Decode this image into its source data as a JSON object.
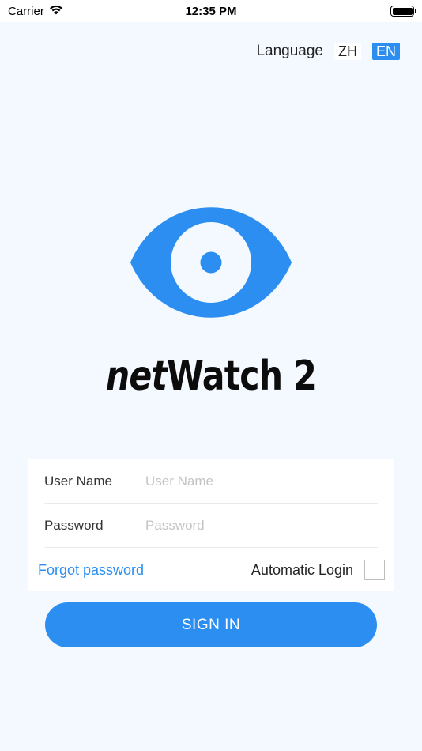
{
  "status_bar": {
    "carrier": "Carrier",
    "time": "12:35 PM",
    "wifi_icon": "wifi-icon",
    "battery_icon": "battery-icon"
  },
  "language": {
    "label": "Language",
    "options": [
      "ZH",
      "EN"
    ],
    "selected": "EN"
  },
  "logo": {
    "icon": "eye-logo-icon",
    "app_name_part1": "net",
    "app_name_part2": "Watch 2",
    "brand_color": "#2b8ef0"
  },
  "form": {
    "username": {
      "label": "User Name",
      "placeholder": "User Name",
      "value": ""
    },
    "password": {
      "label": "Password",
      "placeholder": "Password",
      "value": ""
    },
    "forgot_label": "Forgot password",
    "auto_login_label": "Automatic Login",
    "auto_login_checked": false
  },
  "sign_in_label": "SIGN IN"
}
